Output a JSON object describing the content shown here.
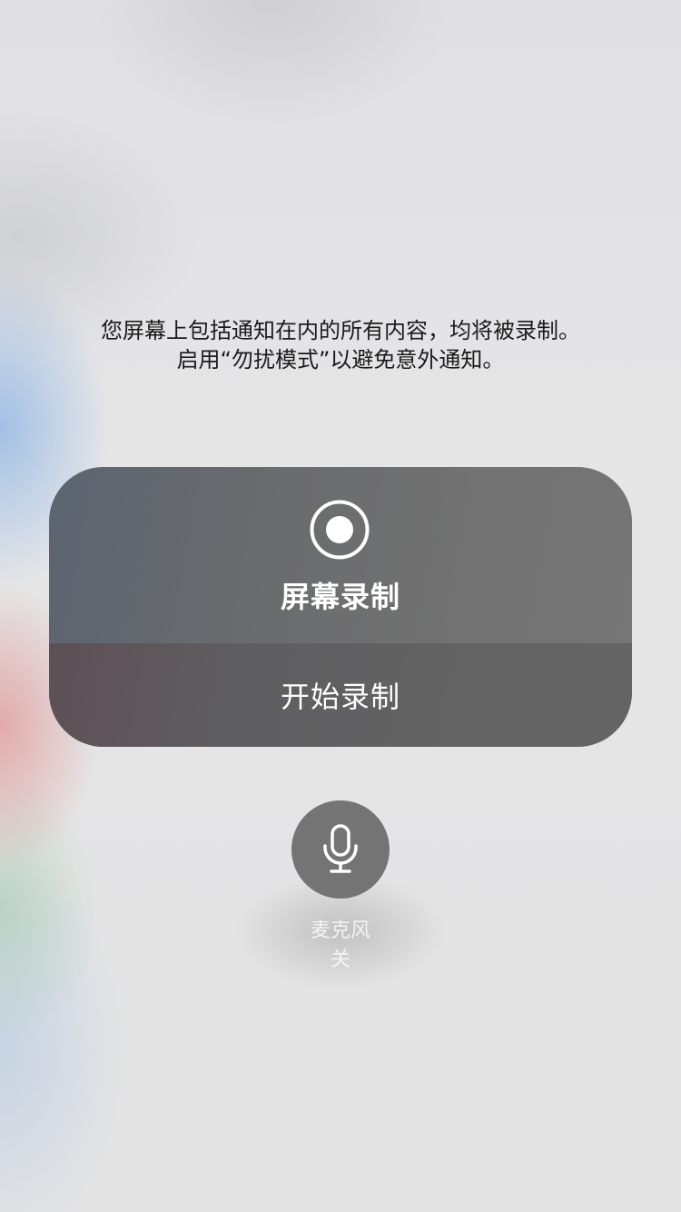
{
  "notice": {
    "line1": "您屏幕上包括通知在内的所有内容，均将被录制。",
    "line2": "启用“勿扰模式”以避免意外通知。"
  },
  "panel": {
    "icon": "record-icon",
    "title": "屏幕录制",
    "start_label": "开始录制"
  },
  "microphone": {
    "icon": "microphone-icon",
    "label": "麦克风",
    "state": "关"
  },
  "colors": {
    "panel_top": "#6e6e6e",
    "panel_bottom": "#636363",
    "mic_button": "#747474",
    "text_light": "#ffffff",
    "text_dark": "#1b1b1b"
  }
}
